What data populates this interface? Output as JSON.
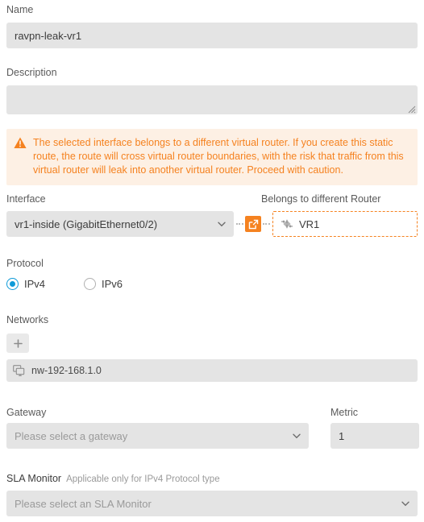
{
  "name_field": {
    "label": "Name",
    "value": "ravpn-leak-vr1"
  },
  "description_field": {
    "label": "Description",
    "value": "",
    "placeholder": ""
  },
  "warning": {
    "icon": "warning-triangle-icon",
    "text": "The selected interface belongs to a different virtual router. If you create this static route, the route will cross virtual router boundaries, with the risk that traffic from this virtual router will leak into another virtual router. Proceed with caution.",
    "accent_color": "#f58220",
    "background_color": "#fdf0e4"
  },
  "interface_field": {
    "label": "Interface",
    "value": "vr1-inside (GigabitEthernet0/2)",
    "open_icon": "external-link-icon",
    "router_badge": {
      "label": "Belongs to different Router",
      "icon": "router-icon",
      "value": "VR1",
      "border_color": "#f58220"
    }
  },
  "protocol_field": {
    "label": "Protocol",
    "selected": "IPv4",
    "accent_color": "#0d9ad8",
    "options": [
      {
        "label": "IPv4",
        "selected": true
      },
      {
        "label": "IPv6",
        "selected": false
      }
    ]
  },
  "networks_field": {
    "label": "Networks",
    "add_button_icon": "plus-icon",
    "items": [
      {
        "icon": "network-object-icon",
        "label": "nw-192-168.1.0"
      }
    ]
  },
  "gateway_field": {
    "label": "Gateway",
    "value": "",
    "placeholder": "Please select a gateway"
  },
  "metric_field": {
    "label": "Metric",
    "value": "1"
  },
  "sla_monitor_field": {
    "label": "SLA Monitor",
    "hint": "Applicable only for IPv4 Protocol type",
    "value": "",
    "placeholder": "Please select an SLA Monitor"
  }
}
